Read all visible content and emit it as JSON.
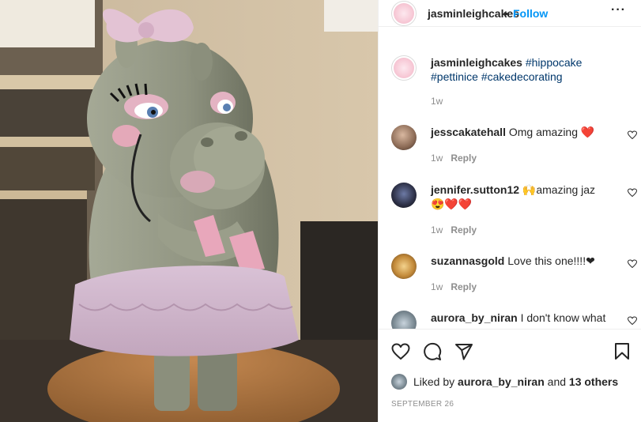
{
  "post": {
    "username": "jasminleighcakes",
    "separator": "•",
    "follow_label": "Follow",
    "more_label": "···",
    "caption": {
      "username": "jasminleighcakes",
      "line1": "#hippocake",
      "line2": "#pettinice #cakedecorating",
      "time": "1w"
    }
  },
  "comments": [
    {
      "username": "jesscakatehall",
      "text": "Omg amazing ❤️",
      "text2": "",
      "time": "1w",
      "reply_label": "Reply"
    },
    {
      "username": "jennifer.sutton12",
      "text": "🙌amazing jaz",
      "text2": "😍❤️❤️",
      "time": "1w",
      "reply_label": "Reply"
    },
    {
      "username": "suzannasgold",
      "text": "Love this one!!!!❤",
      "text2": "",
      "time": "1w",
      "reply_label": "Reply"
    },
    {
      "username": "aurora_by_niran",
      "text": "I don't know what",
      "text2": "",
      "time": "",
      "reply_label": ""
    }
  ],
  "likes": {
    "prefix": "Liked by",
    "user": "aurora_by_niran",
    "joiner": "and",
    "others": "13 others"
  },
  "date": "SEPTEMBER 26",
  "colors": {
    "follow_blue": "#0095f6",
    "hashtag": "#00376b",
    "muted": "#8e8e8e",
    "heart_red": "#ed4956"
  },
  "icons": [
    "heart-icon",
    "comment-icon",
    "share-icon",
    "bookmark-icon",
    "more-icon"
  ]
}
